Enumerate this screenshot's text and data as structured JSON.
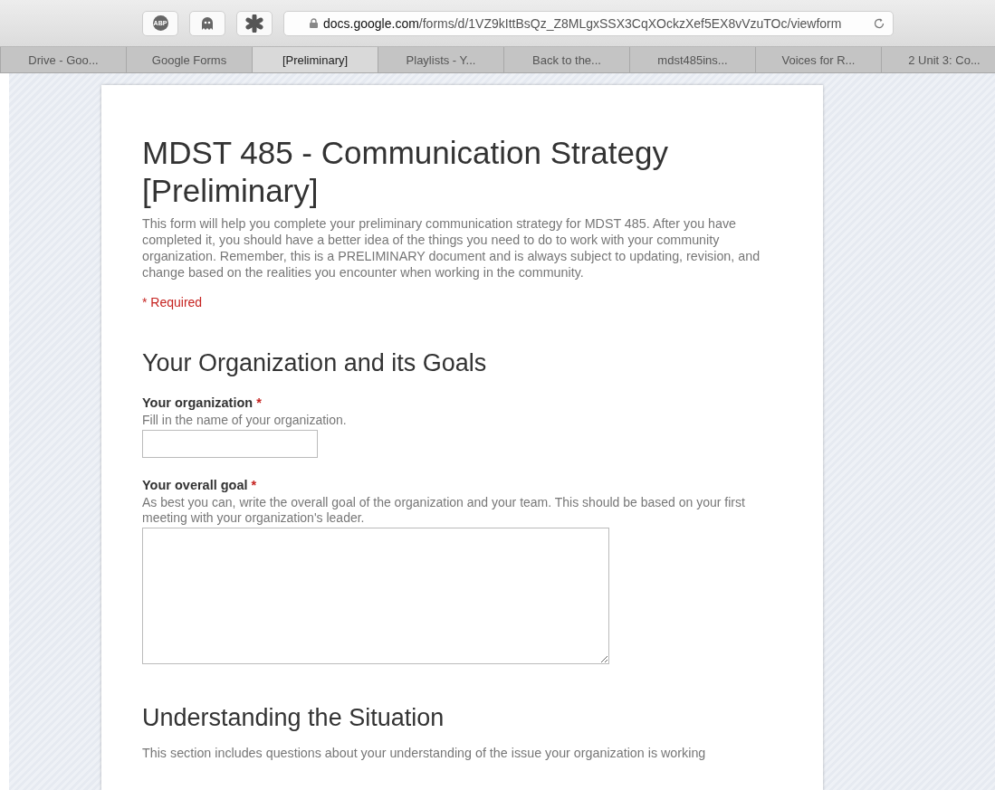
{
  "toolbar": {
    "extensions": [
      {
        "kind": "abp",
        "label": "ABP"
      },
      {
        "kind": "ghost"
      },
      {
        "kind": "puzzle"
      }
    ],
    "url": {
      "host": "docs.google.com",
      "path": "/forms/d/1VZ9kIttBsQz_Z8MLgxSSX3CqXOckzXef5EX8vVzuTOc/viewform"
    }
  },
  "tabs": [
    {
      "label": "Drive - Goo...",
      "selected": false
    },
    {
      "label": "Google Forms",
      "selected": false
    },
    {
      "label": "[Preliminary]",
      "selected": true
    },
    {
      "label": "Playlists - Y...",
      "selected": false
    },
    {
      "label": "Back to the...",
      "selected": false
    },
    {
      "label": "mdst485ins...",
      "selected": false
    },
    {
      "label": "Voices for R...",
      "selected": false
    },
    {
      "label": "2 Unit 3: Co...",
      "selected": false
    }
  ],
  "form": {
    "title": "MDST 485 - Communication Strategy [Preliminary]",
    "description": "This form will help you complete your preliminary communication strategy for MDST 485. After you have completed it, you should have a better idea of the things you need to do to work with your community organization. Remember, this is a PRELIMINARY document and is always subject to updating, revision, and change based on the realities you encounter when working in the community.",
    "required_note": "* Required",
    "sections": [
      {
        "title": "Your Organization and its Goals",
        "questions": [
          {
            "kind": "text",
            "title": "Your organization",
            "required_mark": "*",
            "help": "Fill in the name of your organization."
          },
          {
            "kind": "paragraph",
            "title": "Your overall goal",
            "required_mark": "*",
            "help": "As best you can, write the overall goal of the organization and your team. This should be based on your first meeting with your organization's leader."
          }
        ]
      },
      {
        "title": "Understanding the Situation",
        "description": "This section includes questions about your understanding of the issue your organization is working"
      }
    ]
  }
}
